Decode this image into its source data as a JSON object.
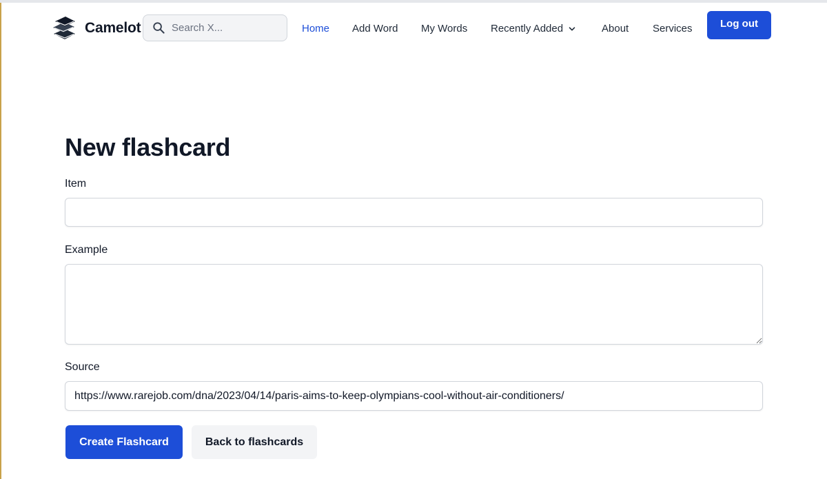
{
  "navbar": {
    "brand": "Camelot",
    "search": {
      "placeholder": "Search X...",
      "value": ""
    },
    "links": {
      "home": "Home",
      "add_word": "Add Word",
      "my_words": "My Words",
      "recently_added": "Recently Added",
      "about": "About",
      "services": "Services"
    },
    "active_link": "home",
    "logout_label": "Log out"
  },
  "form": {
    "title": "New flashcard",
    "item": {
      "label": "Item",
      "value": ""
    },
    "example": {
      "label": "Example",
      "value": ""
    },
    "source": {
      "label": "Source",
      "value": "https://www.rarejob.com/dna/2023/04/14/paris-aims-to-keep-olympians-cool-without-air-conditioners/"
    },
    "create_label": "Create Flashcard",
    "back_label": "Back to flashcards"
  },
  "colors": {
    "primary": "#1d4ed8",
    "secondary_button": "#f3f4f6",
    "text": "#111827",
    "border": "#d1d5db"
  },
  "icons": {
    "brand": "stacked-books-icon",
    "search": "search-icon",
    "dropdown": "chevron-down-icon"
  }
}
